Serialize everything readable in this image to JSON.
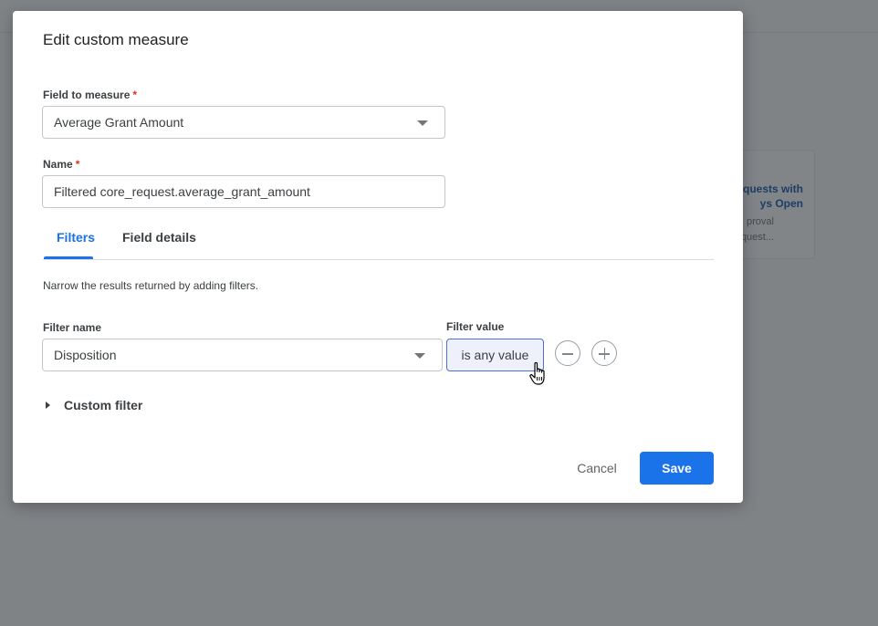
{
  "background": {
    "card_title": "quests with\nys Open",
    "card_desc": "proval\nequest..."
  },
  "dialog": {
    "title": "Edit custom measure",
    "field_to_measure": {
      "label": "Field to measure",
      "required_mark": "*",
      "value": "Average Grant Amount"
    },
    "name": {
      "label": "Name",
      "required_mark": "*",
      "value": "Filtered core_request.average_grant_amount"
    },
    "tabs": [
      {
        "label": "Filters",
        "active": true
      },
      {
        "label": "Field details",
        "active": false
      }
    ],
    "filters": {
      "hint": "Narrow the results returned by adding filters.",
      "filter_name_label": "Filter name",
      "filter_value_label": "Filter value",
      "filter_name_value": "Disposition",
      "filter_value_value": "is any value",
      "custom_filter_label": "Custom filter"
    },
    "actions": {
      "cancel": "Cancel",
      "save": "Save"
    }
  },
  "icons": {
    "dropdown": "chevron-down-icon",
    "remove": "minus-circle-icon",
    "add": "plus-circle-icon",
    "expand": "caret-right-icon",
    "cursor": "hand-pointer-icon"
  },
  "colors": {
    "accent": "#1a73e8",
    "required": "#d93025",
    "overlay": "#7f8386"
  }
}
